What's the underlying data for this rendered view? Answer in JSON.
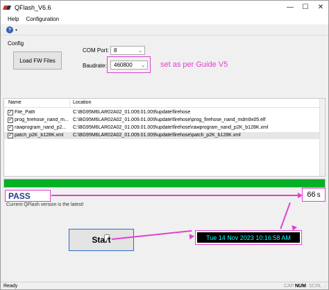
{
  "window": {
    "title": "QFlash_V6.6",
    "controls": {
      "minimize": "—",
      "maximize": "☐",
      "close": "✕"
    }
  },
  "menu": [
    "Help",
    "Configuration"
  ],
  "toolbar": {
    "help_icon": "question-icon",
    "help_glyph": "?",
    "dropdown_glyph": "▾"
  },
  "config": {
    "group_label": "Config",
    "load_button": "Load FW Files",
    "com_port_label": "COM Port:",
    "com_port_value": "8",
    "baudrate_label": "Baudrate:",
    "baudrate_value": "460800",
    "select_chevron": "⌄",
    "annotation": "set as per Guide V5",
    "annotation_color": "#e040d0"
  },
  "files": {
    "columns": [
      "Name",
      "Location"
    ],
    "check_glyph": "✓",
    "rows": [
      {
        "name": "File_Path",
        "location": "C:\\BG95M6LAR02A02_01.009.01.009\\update\\firehose",
        "checked": true
      },
      {
        "name": "prog_firehose_nand_m...",
        "location": "C:\\BG95M6LAR02A02_01.009.01.009\\update\\firehose\\prog_firehose_nand_mdm9x05.elf",
        "checked": true
      },
      {
        "name": "rawprogram_nand_p2...",
        "location": "C:\\BG95M6LAR02A02_01.009.01.009\\update\\firehose\\rawprogram_nand_p2K_b128K.xml",
        "checked": true
      },
      {
        "name": "patch_p2K_b128K.xml",
        "location": "C:\\BG95M6LAR02A02_01.009.01.009\\update\\firehose\\patch_p2K_b128K.xml",
        "checked": true
      }
    ]
  },
  "progress": {
    "percent": 100,
    "color": "#06b025"
  },
  "result": {
    "status": "PASS",
    "elapsed": "66",
    "elapsed_unit": "s",
    "message": "Current QFlash version is the latest!"
  },
  "start_button": "Start",
  "timestamp": "Tue 14 Nov  2023  10:16:58 AM",
  "statusbar": {
    "ready": "Ready",
    "cap": "CAP",
    "num": "NUM",
    "scrl": "SCRL"
  }
}
